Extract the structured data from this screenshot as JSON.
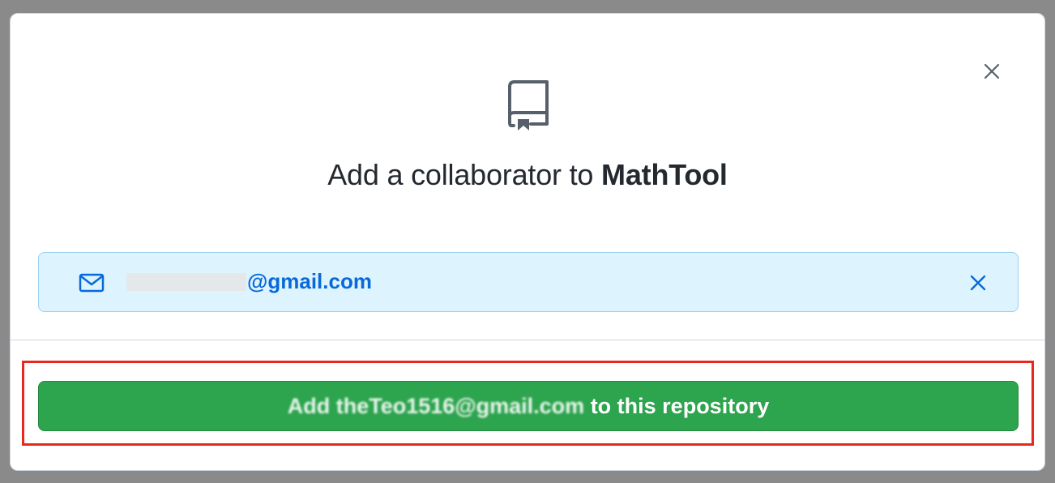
{
  "modal": {
    "title_prefix": "Add a collaborator to ",
    "repo_name": "MathTool",
    "close_icon": "close-icon",
    "repo_icon": "repo-book-icon"
  },
  "email_chip": {
    "icon": "mail-icon",
    "email_visible": "@gmail.com",
    "remove_icon": "close-icon"
  },
  "add_button": {
    "label_obscured": "Add theTeo1516@gmail.com",
    "label_suffix": " to this repository"
  },
  "colors": {
    "button_green": "#2da44e",
    "chip_background": "#ddf4ff",
    "link_blue": "#0969da",
    "highlight_red": "#e8281a"
  }
}
